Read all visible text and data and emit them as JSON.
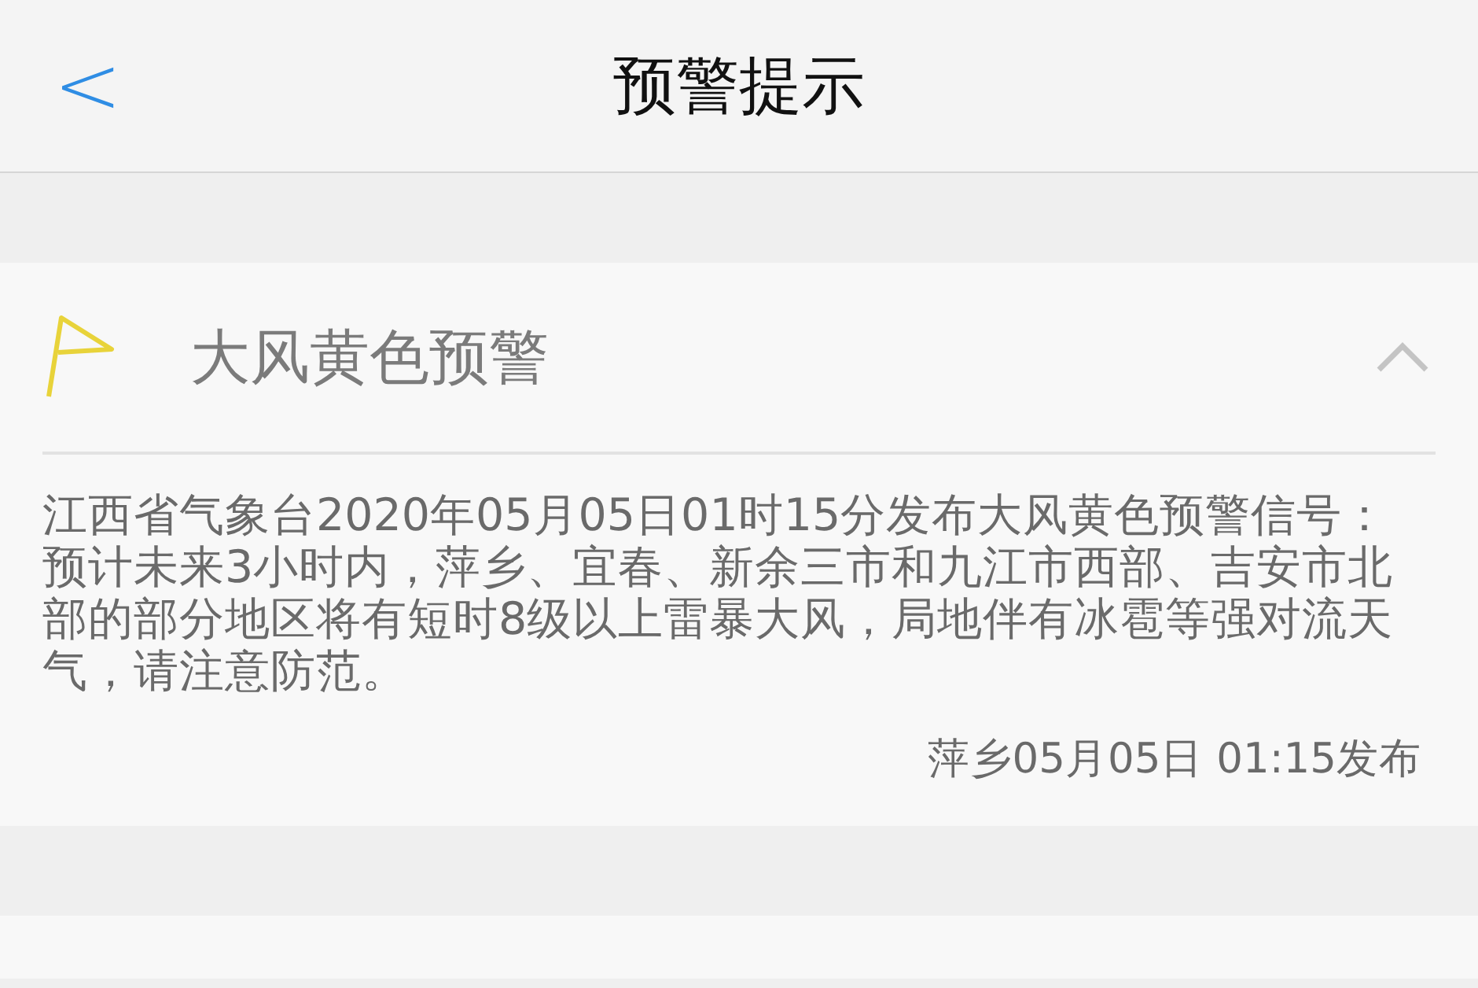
{
  "nav": {
    "back": "<",
    "title": "预警提示"
  },
  "alerts": [
    {
      "title": "大风黄色预警",
      "color": "#e8d33a",
      "expanded": true,
      "message": "江西省气象台2020年05月05日01时15分发布大风黄色预警信号：预计未来3小时内，萍乡、宜春、新余三市和九江市西部、吉安市北部的部分地区将有短时8级以上雷暴大风，局地伴有冰雹等强对流天气，请注意防范。",
      "issued": "萍乡05月05日 01:15发布"
    }
  ]
}
